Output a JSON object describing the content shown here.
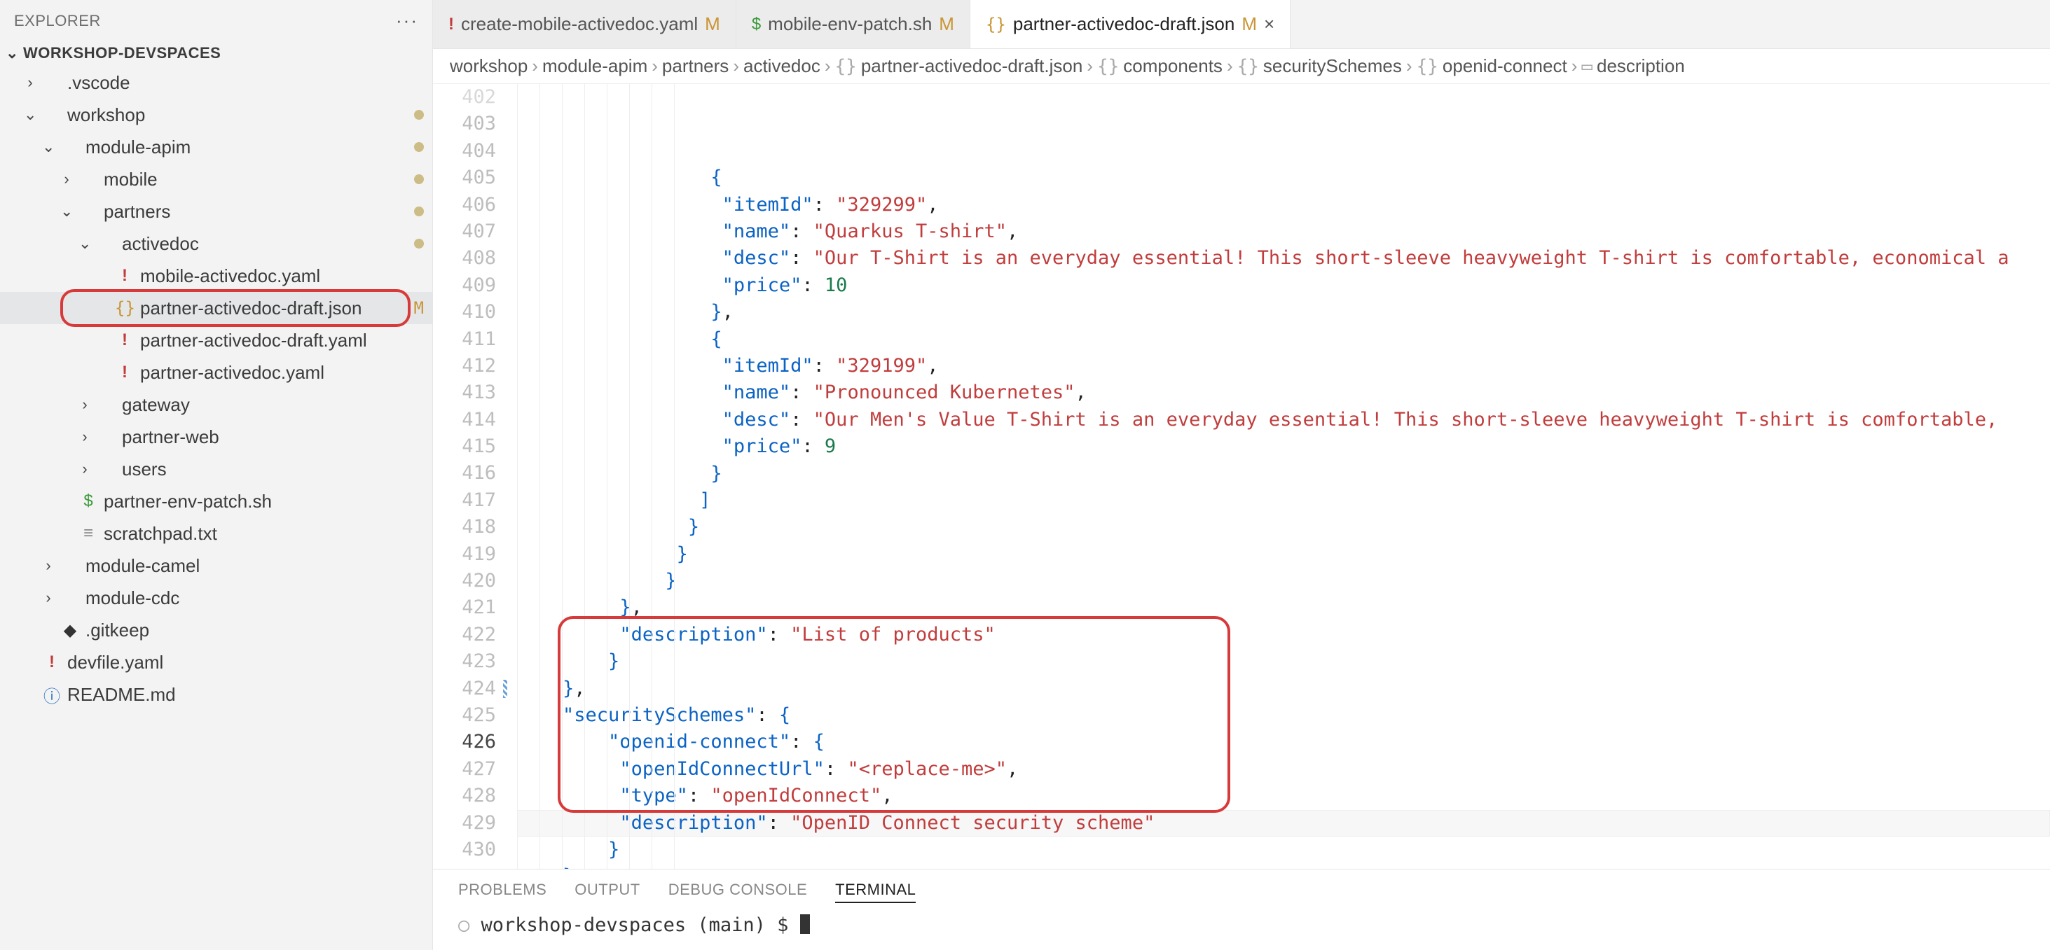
{
  "sidebar": {
    "title": "EXPLORER",
    "workspace": "WORKSHOP-DEVSPACES",
    "rows": [
      {
        "indent": 1,
        "chev": "›",
        "icon": "",
        "label": ".vscode"
      },
      {
        "indent": 1,
        "chev": "⌄",
        "icon": "",
        "label": "workshop",
        "dot": true
      },
      {
        "indent": 2,
        "chev": "⌄",
        "icon": "",
        "label": "module-apim",
        "dot": true
      },
      {
        "indent": 3,
        "chev": "›",
        "icon": "",
        "label": "mobile",
        "dot": true
      },
      {
        "indent": 3,
        "chev": "⌄",
        "icon": "",
        "label": "partners",
        "dot": true
      },
      {
        "indent": 4,
        "chev": "⌄",
        "icon": "",
        "label": "activedoc",
        "dot": true
      },
      {
        "indent": 5,
        "chev": "",
        "icon": "!",
        "iconClass": "yaml",
        "label": "mobile-activedoc.yaml"
      },
      {
        "indent": 5,
        "chev": "",
        "icon": "{}",
        "iconClass": "json",
        "label": "partner-activedoc-draft.json",
        "git": "M",
        "selected": true
      },
      {
        "indent": 5,
        "chev": "",
        "icon": "!",
        "iconClass": "yaml",
        "label": "partner-activedoc-draft.yaml"
      },
      {
        "indent": 5,
        "chev": "",
        "icon": "!",
        "iconClass": "yaml",
        "label": "partner-activedoc.yaml"
      },
      {
        "indent": 4,
        "chev": "›",
        "icon": "",
        "label": "gateway"
      },
      {
        "indent": 4,
        "chev": "›",
        "icon": "",
        "label": "partner-web"
      },
      {
        "indent": 4,
        "chev": "›",
        "icon": "",
        "label": "users"
      },
      {
        "indent": 3,
        "chev": "",
        "icon": "$",
        "iconClass": "sh",
        "label": "partner-env-patch.sh"
      },
      {
        "indent": 3,
        "chev": "",
        "icon": "≡",
        "iconClass": "txt",
        "label": "scratchpad.txt"
      },
      {
        "indent": 2,
        "chev": "›",
        "icon": "",
        "label": "module-camel"
      },
      {
        "indent": 2,
        "chev": "›",
        "icon": "",
        "label": "module-cdc"
      },
      {
        "indent": 2,
        "chev": "",
        "icon": "◆",
        "iconClass": "diamond",
        "label": ".gitkeep"
      },
      {
        "indent": 1,
        "chev": "",
        "icon": "!",
        "iconClass": "yaml",
        "label": "devfile.yaml"
      },
      {
        "indent": 1,
        "chev": "",
        "icon": "ⓘ",
        "iconClass": "readme",
        "label": "README.md"
      }
    ]
  },
  "tabs": [
    {
      "icon": "!",
      "iconClass": "yaml",
      "label": "create-mobile-activedoc.yaml",
      "mod": "M"
    },
    {
      "icon": "$",
      "iconClass": "sh",
      "label": "mobile-env-patch.sh",
      "mod": "M"
    },
    {
      "icon": "{}",
      "iconClass": "json",
      "label": "partner-activedoc-draft.json",
      "mod": "M",
      "active": true,
      "close": "×"
    }
  ],
  "breadcrumbs": [
    {
      "t": "workshop"
    },
    {
      "t": "module-apim"
    },
    {
      "t": "partners"
    },
    {
      "t": "activedoc"
    },
    {
      "icon": "{}",
      "t": "partner-activedoc-draft.json"
    },
    {
      "icon": "{}",
      "t": "components"
    },
    {
      "icon": "{}",
      "t": "securitySchemes"
    },
    {
      "icon": "{}",
      "t": "openid-connect"
    },
    {
      "icon": "▭",
      "t": "description"
    }
  ],
  "code": {
    "first_line": 402,
    "current_line": 426,
    "lines": [
      {
        "n": 402,
        "faded": true,
        "indent": 17,
        "raw": "{"
      },
      {
        "n": 403,
        "indent": 18,
        "segs": [
          [
            "k",
            "\"itemId\""
          ],
          [
            "p",
            ": "
          ],
          [
            "s",
            "\"329299\""
          ],
          [
            "p",
            ","
          ]
        ]
      },
      {
        "n": 404,
        "indent": 18,
        "segs": [
          [
            "k",
            "\"name\""
          ],
          [
            "p",
            ": "
          ],
          [
            "s",
            "\"Quarkus T-shirt\""
          ],
          [
            "p",
            ","
          ]
        ]
      },
      {
        "n": 405,
        "indent": 18,
        "segs": [
          [
            "k",
            "\"desc\""
          ],
          [
            "p",
            ": "
          ],
          [
            "s",
            "\"Our T-Shirt is an everyday essential! This short-sleeve heavyweight T-shirt is comfortable, economical a"
          ]
        ]
      },
      {
        "n": 406,
        "indent": 18,
        "segs": [
          [
            "k",
            "\"price\""
          ],
          [
            "p",
            ": "
          ],
          [
            "n",
            "10"
          ]
        ]
      },
      {
        "n": 407,
        "indent": 17,
        "segs": [
          [
            "br",
            "}"
          ],
          [
            "p",
            ","
          ]
        ]
      },
      {
        "n": 408,
        "indent": 17,
        "segs": [
          [
            "br",
            "{"
          ]
        ]
      },
      {
        "n": 409,
        "indent": 18,
        "segs": [
          [
            "k",
            "\"itemId\""
          ],
          [
            "p",
            ": "
          ],
          [
            "s",
            "\"329199\""
          ],
          [
            "p",
            ","
          ]
        ]
      },
      {
        "n": 410,
        "indent": 18,
        "segs": [
          [
            "k",
            "\"name\""
          ],
          [
            "p",
            ": "
          ],
          [
            "s",
            "\"Pronounced Kubernetes\""
          ],
          [
            "p",
            ","
          ]
        ]
      },
      {
        "n": 411,
        "indent": 18,
        "segs": [
          [
            "k",
            "\"desc\""
          ],
          [
            "p",
            ": "
          ],
          [
            "s",
            "\"Our Men's Value T-Shirt is an everyday essential! This short-sleeve heavyweight T-shirt is comfortable,"
          ]
        ]
      },
      {
        "n": 412,
        "indent": 18,
        "segs": [
          [
            "k",
            "\"price\""
          ],
          [
            "p",
            ": "
          ],
          [
            "n",
            "9"
          ]
        ]
      },
      {
        "n": 413,
        "indent": 17,
        "segs": [
          [
            "br",
            "}"
          ]
        ]
      },
      {
        "n": 414,
        "indent": 16,
        "segs": [
          [
            "br",
            "]"
          ]
        ]
      },
      {
        "n": 415,
        "indent": 15,
        "segs": [
          [
            "br",
            "}"
          ]
        ]
      },
      {
        "n": 416,
        "indent": 14,
        "segs": [
          [
            "br",
            "}"
          ]
        ]
      },
      {
        "n": 417,
        "indent": 13,
        "segs": [
          [
            "br",
            "}"
          ]
        ]
      },
      {
        "n": 418,
        "indent": 9,
        "segs": [
          [
            "br",
            "}"
          ],
          [
            "p",
            ","
          ]
        ]
      },
      {
        "n": 419,
        "indent": 9,
        "segs": [
          [
            "k",
            "\"description\""
          ],
          [
            "p",
            ": "
          ],
          [
            "s",
            "\"List of products\""
          ]
        ]
      },
      {
        "n": 420,
        "indent": 8,
        "segs": [
          [
            "br",
            "}"
          ]
        ]
      },
      {
        "n": 421,
        "indent": 4,
        "segs": [
          [
            "br",
            "}"
          ],
          [
            "p",
            ","
          ]
        ]
      },
      {
        "n": 422,
        "indent": 4,
        "segs": [
          [
            "k",
            "\"securitySchemes\""
          ],
          [
            "p",
            ": "
          ],
          [
            "br",
            "{"
          ]
        ]
      },
      {
        "n": 423,
        "indent": 8,
        "segs": [
          [
            "k",
            "\"openid-connect\""
          ],
          [
            "p",
            ": "
          ],
          [
            "br",
            "{"
          ]
        ]
      },
      {
        "n": 424,
        "glyph": true,
        "indent": 9,
        "segs": [
          [
            "k",
            "\"openIdConnectUrl\""
          ],
          [
            "p",
            ": "
          ],
          [
            "s",
            "\"<replace-me>\""
          ],
          [
            "p",
            ","
          ]
        ]
      },
      {
        "n": 425,
        "indent": 9,
        "segs": [
          [
            "k",
            "\"type\""
          ],
          [
            "p",
            ": "
          ],
          [
            "s",
            "\"openIdConnect\""
          ],
          [
            "p",
            ","
          ]
        ]
      },
      {
        "n": 426,
        "cur": true,
        "indent": 9,
        "segs": [
          [
            "k",
            "\"description\""
          ],
          [
            "p",
            ": "
          ],
          [
            "s",
            "\"OpenID Connect security scheme\""
          ]
        ]
      },
      {
        "n": 427,
        "indent": 8,
        "segs": [
          [
            "br",
            "}"
          ]
        ]
      },
      {
        "n": 428,
        "indent": 4,
        "segs": [
          [
            "br",
            "}"
          ]
        ]
      },
      {
        "n": 429,
        "indent": 2,
        "segs": [
          [
            "br",
            "}"
          ]
        ]
      },
      {
        "n": 430,
        "indent": 0,
        "segs": [
          [
            "br",
            "}"
          ]
        ]
      }
    ]
  },
  "panel": {
    "tabs": [
      "PROBLEMS",
      "OUTPUT",
      "DEBUG CONSOLE",
      "TERMINAL"
    ],
    "active": "TERMINAL",
    "terminal_prompt": "workshop-devspaces (main) $ "
  }
}
